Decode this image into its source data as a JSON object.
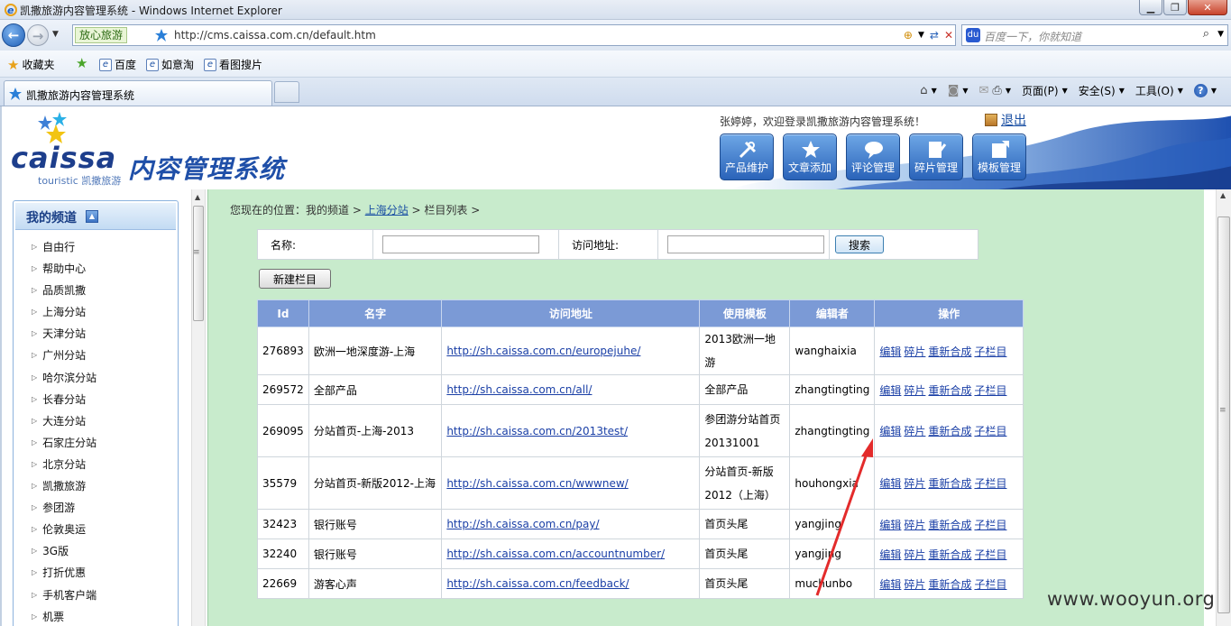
{
  "window": {
    "title": "凯撒旅游内容管理系统 - Windows Internet Explorer"
  },
  "addressbar": {
    "safe_badge": "放心旅游",
    "url": "http://cms.caissa.com.cn/default.htm",
    "search_placeholder": "百度一下，你就知道"
  },
  "favorites": {
    "items": [
      "收藏夹",
      "百度",
      "如意淘",
      "看图搜片"
    ]
  },
  "tab": {
    "label": "凯撒旅游内容管理系统"
  },
  "commandbar": {
    "page": "页面(P)",
    "safety": "安全(S)",
    "tools": "工具(O)"
  },
  "header": {
    "logo_text": "caissa",
    "logo_sub": "touristic 凯撒旅游",
    "system_title": "内容管理系统",
    "welcome": "张婷婷，欢迎登录凯撒旅游内容管理系统！",
    "logout": "退出",
    "buttons": [
      "产品维护",
      "文章添加",
      "评论管理",
      "碎片管理",
      "模板管理"
    ]
  },
  "sidebar": {
    "title": "我的频道",
    "items": [
      "自由行",
      "帮助中心",
      "品质凯撒",
      "上海分站",
      "天津分站",
      "广州分站",
      "哈尔滨分站",
      "长春分站",
      "大连分站",
      "石家庄分站",
      "北京分站",
      "凯撒旅游",
      "参团游",
      "伦敦奥运",
      "3G版",
      "打折优惠",
      "手机客户端",
      "机票"
    ]
  },
  "breadcrumb": {
    "prefix": "您现在的位置：我的频道 >",
    "link": "上海分站",
    "suffix": "> 栏目列表 >"
  },
  "search": {
    "name_label": "名称:",
    "name_value": "",
    "url_label": "访问地址:",
    "url_value": "",
    "button": "搜索"
  },
  "new_button": "新建栏目",
  "table": {
    "headers": [
      "Id",
      "名字",
      "访问地址",
      "使用模板",
      "编辑者",
      "操作"
    ],
    "ops": [
      "编辑",
      "碎片",
      "重新合成",
      "子栏目"
    ],
    "rows": [
      {
        "id": "276893",
        "name": "欧洲一地深度游-上海",
        "url": "http://sh.caissa.com.cn/europejuhe/",
        "template": "2013欧洲一地游",
        "editor": "wanghaixia"
      },
      {
        "id": "269572",
        "name": "全部产品",
        "url": "http://sh.caissa.com.cn/all/",
        "template": "全部产品",
        "editor": "zhangtingting"
      },
      {
        "id": "269095",
        "name": "分站首页-上海-2013",
        "url": "http://sh.caissa.com.cn/2013test/",
        "template": "参团游分站首页20131001",
        "editor": "zhangtingting"
      },
      {
        "id": "35579",
        "name": "分站首页-新版2012-上海",
        "url": "http://sh.caissa.com.cn/wwwnew/",
        "template": "分站首页-新版2012（上海）",
        "editor": "houhongxia"
      },
      {
        "id": "32423",
        "name": "银行账号",
        "url": "http://sh.caissa.com.cn/pay/",
        "template": "首页头尾",
        "editor": "yangjing"
      },
      {
        "id": "32240",
        "name": "银行账号",
        "url": "http://sh.caissa.com.cn/accountnumber/",
        "template": "首页头尾",
        "editor": "yangjing"
      },
      {
        "id": "22669",
        "name": "游客心声",
        "url": "http://sh.caissa.com.cn/feedback/",
        "template": "首页头尾",
        "editor": "muchunbo"
      }
    ]
  },
  "watermark": "www.wooyun.org",
  "colors": {
    "content_bg": "#c8ebcc",
    "table_header": "#7b9ad6",
    "link": "#1a3fa6",
    "annotation_arrow": "#e32b2b"
  }
}
